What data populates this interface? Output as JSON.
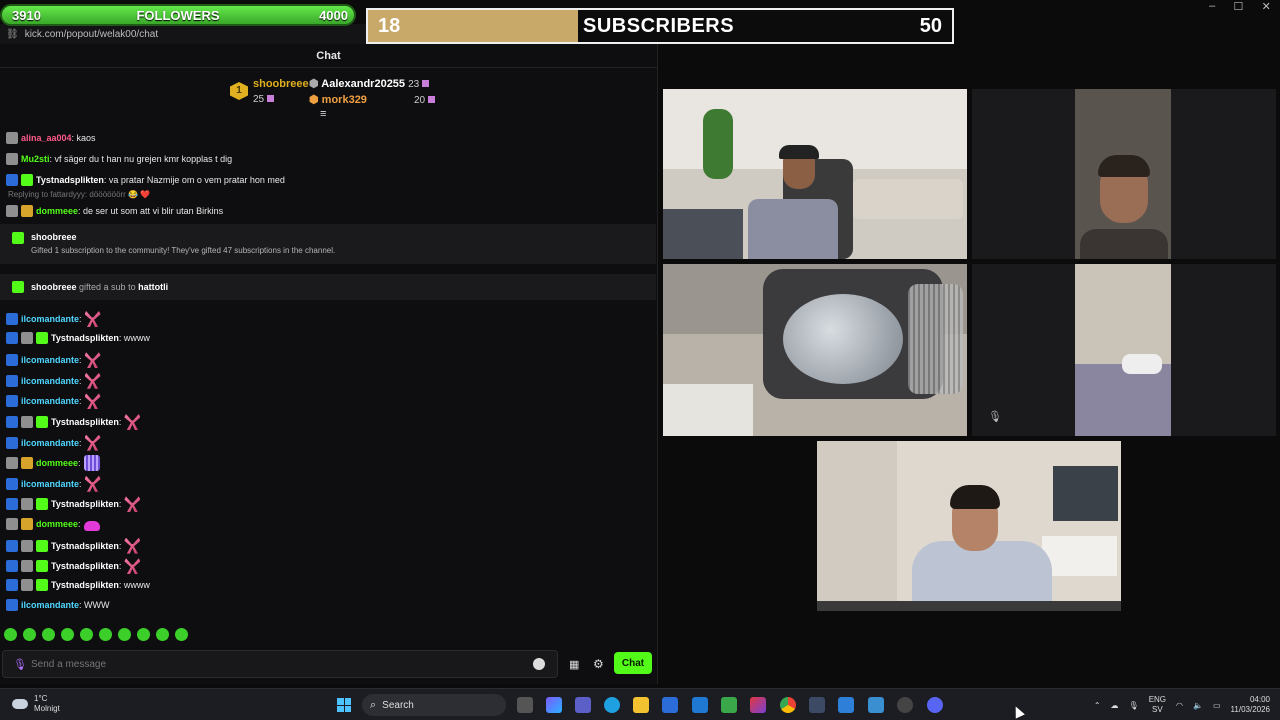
{
  "overlay": {
    "followers": {
      "current": "3910",
      "label": "FOLLOWERS",
      "goal": "4000",
      "progress": 0.9775
    },
    "subscribers": {
      "current": "18",
      "label": "SUBSCRIBERS",
      "goal": "50",
      "progress": 0.36
    }
  },
  "browser": {
    "url": "kick.com/popout/welak00/chat"
  },
  "chat": {
    "header": "Chat",
    "leaderboard": [
      {
        "rank": "1",
        "name": "shoobreee",
        "count": "25",
        "color": "#e0b020"
      },
      {
        "name": "Aalexandr20255",
        "count": "23",
        "color": "#ffffff"
      },
      {
        "name": "mork329",
        "count": "20",
        "color": "#f0a040"
      }
    ],
    "messages": [
      {
        "user": "alina_aa004",
        "color": "#ff5a8a",
        "text": ": kaos",
        "badges": [
          "sub"
        ]
      },
      {
        "user": "Mu2sti",
        "color": "#53fc18",
        "text": ": vf säger du t han nu grejen kmr kopplas t dig",
        "badges": [
          "sub"
        ]
      },
      {
        "user": "Tystnadsplikten",
        "color": "#ffffff",
        "text": ": va pratar Nazmije om o vem pratar hon med",
        "badges": [
          "mod",
          "gift"
        ]
      },
      {
        "user": "dommeee",
        "color": "#53fc18",
        "text": ": de ser ut som att vi blir utan Birkins",
        "badges": [
          "sub",
          "gold"
        ],
        "reply": "Replying to fattardyyy: döööööörr 😂 ❤️"
      }
    ],
    "sub_event_1": {
      "name": "shoobreee",
      "text": "Gifted 1 subscription to the community! They've gifted 47 subscriptions in the channel."
    },
    "sub_event_2": {
      "name": "shoobreee",
      "mid": "gifted a sub to",
      "target": "hattotli"
    },
    "emote_messages": [
      {
        "user": "ilcomandante",
        "color": "#4fd7ff",
        "text": ":",
        "emote": "ribbon",
        "badges": [
          "mod"
        ]
      },
      {
        "user": "Tystnadsplikten",
        "color": "#ffffff",
        "text": ": wwww",
        "emote": "",
        "badges": [
          "mod",
          "sub",
          "gift"
        ]
      },
      {
        "user": "ilcomandante",
        "color": "#4fd7ff",
        "text": ":",
        "emote": "ribbon",
        "badges": [
          "mod"
        ]
      },
      {
        "user": "ilcomandante",
        "color": "#4fd7ff",
        "text": ":",
        "emote": "ribbon",
        "badges": [
          "mod"
        ]
      },
      {
        "user": "ilcomandante",
        "color": "#4fd7ff",
        "text": ":",
        "emote": "ribbon",
        "badges": [
          "mod"
        ]
      },
      {
        "user": "Tystnadsplikten",
        "color": "#ffffff",
        "text": ":",
        "emote": "ribbon",
        "badges": [
          "mod",
          "sub",
          "gift"
        ]
      },
      {
        "user": "ilcomandante",
        "color": "#4fd7ff",
        "text": ":",
        "emote": "ribbon",
        "badges": [
          "mod"
        ]
      },
      {
        "user": "dommeee",
        "color": "#53fc18",
        "text": ":",
        "emote": "grid",
        "badges": [
          "sub",
          "gold"
        ]
      },
      {
        "user": "ilcomandante",
        "color": "#4fd7ff",
        "text": ":",
        "emote": "ribbon",
        "badges": [
          "mod"
        ]
      },
      {
        "user": "Tystnadsplikten",
        "color": "#ffffff",
        "text": ":",
        "emote": "ribbon",
        "badges": [
          "mod",
          "sub",
          "gift"
        ]
      },
      {
        "user": "dommeee",
        "color": "#53fc18",
        "text": ":",
        "emote": "car",
        "badges": [
          "sub",
          "gold"
        ]
      },
      {
        "user": "Tystnadsplikten",
        "color": "#ffffff",
        "text": ":",
        "emote": "ribbon",
        "badges": [
          "mod",
          "sub",
          "gift"
        ]
      },
      {
        "user": "Tystnadsplikten",
        "color": "#ffffff",
        "text": ":",
        "emote": "ribbon",
        "badges": [
          "mod",
          "sub",
          "gift"
        ]
      },
      {
        "user": "Tystnadsplikten",
        "color": "#ffffff",
        "text": ": wwww",
        "emote": "",
        "badges": [
          "mod",
          "sub",
          "gift"
        ]
      },
      {
        "user": "ilcomandante",
        "color": "#4fd7ff",
        "text": ": WWW",
        "emote": "",
        "badges": [
          "mod"
        ]
      }
    ],
    "input_placeholder": "Send a message",
    "send_label": "Chat"
  },
  "taskbar": {
    "weather_temp": "1°C",
    "weather_desc": "Molnigt",
    "search_label": "Search",
    "lang_1": "ENG",
    "lang_2": "SV",
    "time": "04:00",
    "date": "11/03/2026"
  },
  "colors": {
    "kick_green": "#53fc18",
    "subs_fill": "#c8a96a",
    "accent_blue": "#4fd7ff"
  }
}
